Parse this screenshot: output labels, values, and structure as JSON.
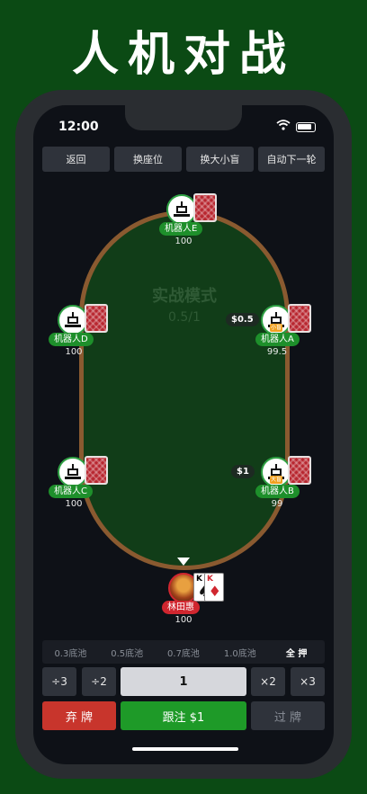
{
  "headline": "人机对战",
  "status_bar": {
    "time": "12:00",
    "wifi_icon": "wifi-icon",
    "battery_icon": "battery-icon"
  },
  "top_buttons": {
    "back": "返回",
    "change_seat": "换座位",
    "change_blinds": "换大小盲",
    "auto_next": "自动下一轮"
  },
  "table": {
    "mode_label": "实战模式",
    "blinds_label": "0.5/1"
  },
  "players": {
    "e": {
      "name": "机器人E",
      "stack": "100"
    },
    "d": {
      "name": "机器人D",
      "stack": "100"
    },
    "a": {
      "name": "机器人A",
      "stack": "99.5",
      "badge": "小盲",
      "bet": "$0.5"
    },
    "c": {
      "name": "机器人C",
      "stack": "100"
    },
    "b": {
      "name": "机器人B",
      "stack": "99",
      "badge": "大盲",
      "bet": "$1"
    },
    "hero": {
      "name": "林田惠",
      "stack": "100",
      "cards": [
        {
          "rank": "K",
          "suit": "♠"
        },
        {
          "rank": "K",
          "suit": "♦"
        }
      ]
    }
  },
  "pot_options": [
    "0.3底池",
    "0.5底池",
    "0.7底池",
    "1.0底池",
    "全 押"
  ],
  "bet_controls": {
    "div3": "÷3",
    "div2": "÷2",
    "amount": "1",
    "mul2": "×2",
    "mul3": "×3"
  },
  "actions": {
    "fold": "弃 牌",
    "call": "跟注 $1",
    "check": "过 牌"
  },
  "colors": {
    "background": "#0b4a14",
    "felt": "#113d18",
    "rail": "#8a5a30",
    "name_pill": "#1e8f2b",
    "hero_pill": "#d0262f",
    "fold": "#c8352c",
    "call": "#1e9a28"
  }
}
